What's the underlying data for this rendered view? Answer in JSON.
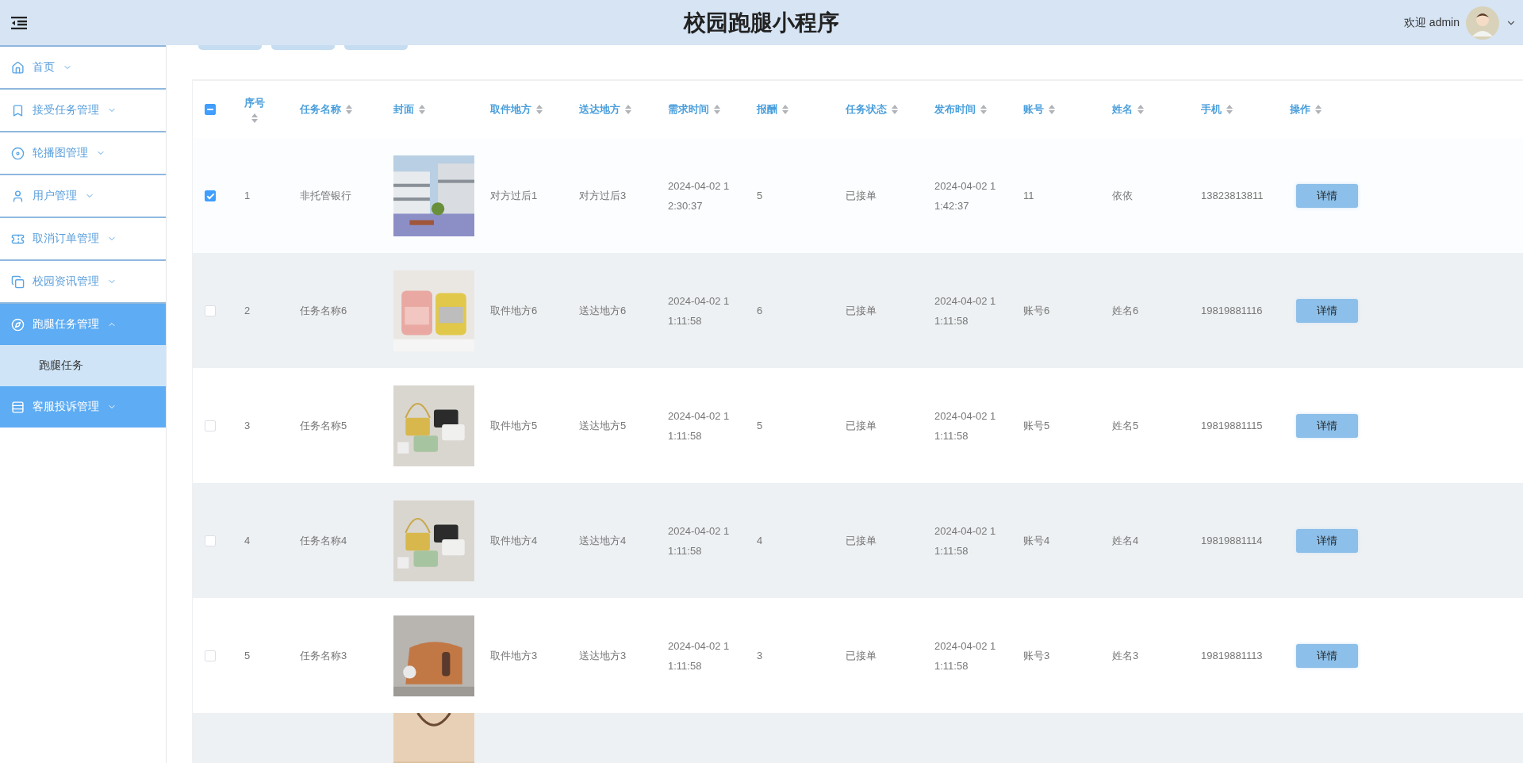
{
  "header": {
    "title": "校园跑腿小程序",
    "welcome": "欢迎 admin"
  },
  "sidebar": {
    "items": [
      {
        "label": "首页",
        "highlighted": false,
        "expanded": false
      },
      {
        "label": "接受任务管理",
        "highlighted": false,
        "expanded": false
      },
      {
        "label": "轮播图管理",
        "highlighted": false,
        "expanded": false
      },
      {
        "label": "用户管理",
        "highlighted": false,
        "expanded": false
      },
      {
        "label": "取消订单管理",
        "highlighted": false,
        "expanded": false
      },
      {
        "label": "校园资讯管理",
        "highlighted": false,
        "expanded": false
      },
      {
        "label": "跑腿任务管理",
        "highlighted": true,
        "expanded": true,
        "children": [
          {
            "label": "跑腿任务",
            "selected": true
          }
        ]
      },
      {
        "label": "客服投诉管理",
        "highlighted": true,
        "expanded": false
      }
    ]
  },
  "table": {
    "select_all": {
      "indeterminate": true
    },
    "columns": [
      "序号",
      "任务名称",
      "封面",
      "取件地方",
      "送达地方",
      "需求时间",
      "报酬",
      "任务状态",
      "发布时间",
      "账号",
      "姓名",
      "手机",
      "操作"
    ],
    "rows": [
      {
        "kind": "full",
        "selected": true,
        "cells": [
          "1",
          "非托管银行",
          null,
          "对方过后1",
          "对方过后3",
          "2024-04-02 12:30:37",
          "5",
          "已接单",
          "2024-04-02 11:42:37",
          "11",
          "依依",
          "13823813811"
        ],
        "action": "详情"
      },
      {
        "kind": "full",
        "selected": false,
        "cells": [
          "2",
          "任务名称6",
          null,
          "取件地方6",
          "送达地方6",
          "2024-04-02 11:11:58",
          "6",
          "已接单",
          "2024-04-02 11:11:58",
          "账号6",
          "姓名6",
          "19819881116"
        ],
        "action": "详情"
      },
      {
        "kind": "full",
        "selected": false,
        "cells": [
          "3",
          "任务名称5",
          null,
          "取件地方5",
          "送达地方5",
          "2024-04-02 11:11:58",
          "5",
          "已接单",
          "2024-04-02 11:11:58",
          "账号5",
          "姓名5",
          "19819881115"
        ],
        "action": "详情"
      },
      {
        "kind": "full",
        "selected": false,
        "cells": [
          "4",
          "任务名称4",
          null,
          "取件地方4",
          "送达地方4",
          "2024-04-02 11:11:58",
          "4",
          "已接单",
          "2024-04-02 11:11:58",
          "账号4",
          "姓名4",
          "19819881114"
        ],
        "action": "详情"
      },
      {
        "kind": "full",
        "selected": false,
        "cells": [
          "5",
          "任务名称3",
          null,
          "取件地方3",
          "送达地方3",
          "2024-04-02 11:11:58",
          "3",
          "已接单",
          "2024-04-02 11:11:58",
          "账号3",
          "姓名3",
          "19819881113"
        ],
        "action": "详情"
      },
      {
        "kind": "partial"
      }
    ]
  }
}
